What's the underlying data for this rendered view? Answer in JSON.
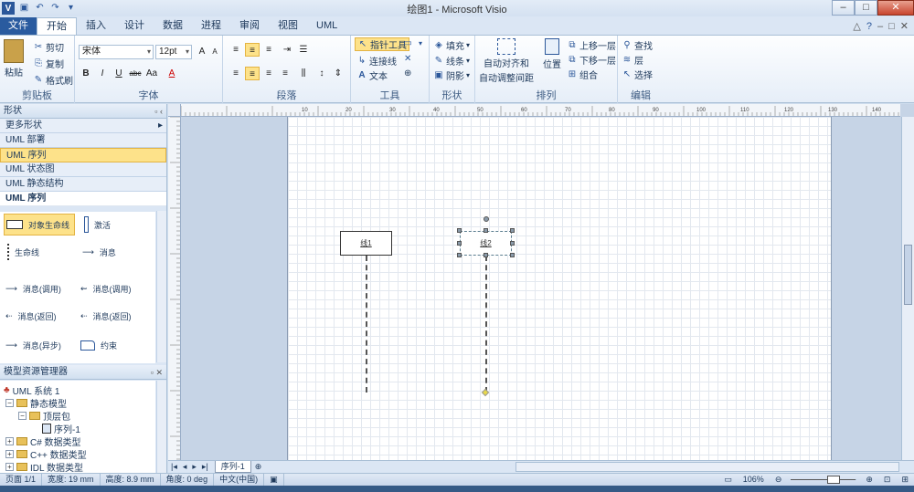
{
  "window": {
    "title": "绘图1  -  Microsoft Visio"
  },
  "tabs": {
    "file": "文件",
    "items": [
      "开始",
      "插入",
      "设计",
      "数据",
      "进程",
      "审阅",
      "视图",
      "UML"
    ]
  },
  "ribbon": {
    "clipboard": {
      "label": "剪贴板",
      "paste": "粘贴",
      "cut": "剪切",
      "copy": "复制",
      "format_painter": "格式刷"
    },
    "font": {
      "label": "字体",
      "font_name": "宋体",
      "font_size": "12pt"
    },
    "paragraph": {
      "label": "段落"
    },
    "tools": {
      "label": "工具",
      "pointer": "指针工具",
      "connector": "连接线",
      "text": "文本"
    },
    "shape": {
      "label": "形状",
      "fill": "填充",
      "line": "线条",
      "shadow": "阴影"
    },
    "arrange": {
      "label": "排列",
      "auto_align": "自动对齐和",
      "auto_space": "自动调整间距",
      "position": "位置",
      "bring_forward": "上移一层",
      "send_backward": "下移一层",
      "group": "组合"
    },
    "editing": {
      "label": "编辑",
      "find": "查找",
      "layer": "层",
      "select": "选择"
    }
  },
  "shapes_panel": {
    "title": "形状",
    "more": "更多形状",
    "stencils": [
      "UML 部署",
      "UML 序列",
      "UML 状态图",
      "UML 静态结构"
    ],
    "selected_stencil": "UML 序列",
    "section_title": "UML 序列",
    "shapes": [
      "对象生命线",
      "激活",
      "生命线",
      "消息",
      "消息(调用)",
      "消息(调用)",
      "消息(返回)",
      "消息(返回)",
      "消息(异步)",
      "约束"
    ]
  },
  "model_explorer": {
    "title": "模型资源管理器",
    "items": [
      "UML 系统 1",
      "静态模型",
      "顶层包",
      "序列-1",
      "C# 数据类型",
      "C++ 数据类型",
      "IDL 数据类型"
    ]
  },
  "canvas": {
    "lifelines": [
      "线1",
      "线2"
    ],
    "page_tab": "序列-1",
    "ruler_labels": [
      "10",
      "20",
      "30",
      "40",
      "50",
      "60",
      "70",
      "80",
      "90",
      "100",
      "110",
      "120",
      "130",
      "140",
      "150"
    ]
  },
  "status": {
    "page": "页面 1/1",
    "width": "宽度: 19 mm",
    "height": "高度: 8.9 mm",
    "angle": "角度: 0 deg",
    "lang": "中文(中国)",
    "zoom": "106%"
  }
}
